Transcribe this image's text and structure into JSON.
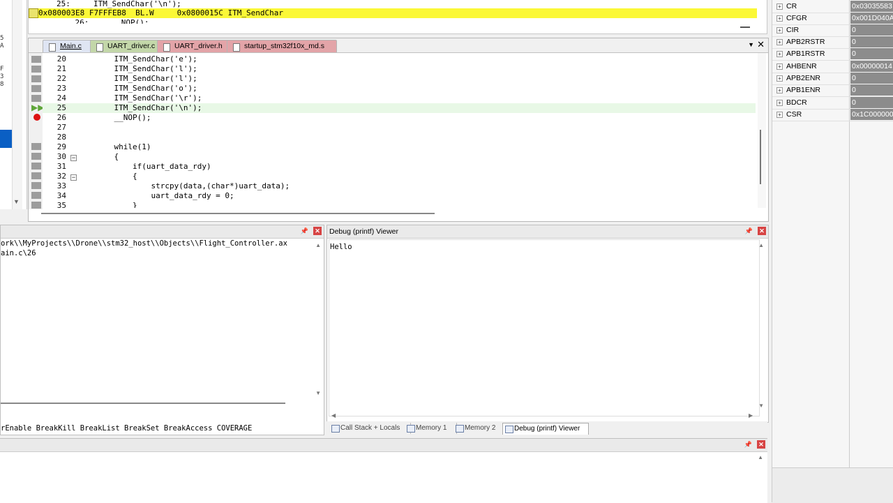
{
  "disassembly": {
    "lines": [
      {
        "text": "25:     ITM_SendChar('\\n');"
      },
      {
        "text": "0x080003E8 F7FFFEB8  BL.W     0x0800015C ITM_SendChar"
      },
      {
        "text": "    26:     __NOP();"
      }
    ]
  },
  "editor": {
    "tabs": [
      {
        "label": "Main.c"
      },
      {
        "label": "UART_driver.c"
      },
      {
        "label": "UART_driver.h"
      },
      {
        "label": "startup_stm32f10x_md.s"
      }
    ],
    "lines": [
      {
        "num": "20",
        "code": "    ITM_SendChar('e');"
      },
      {
        "num": "21",
        "code": "    ITM_SendChar('l');"
      },
      {
        "num": "22",
        "code": "    ITM_SendChar('l');"
      },
      {
        "num": "23",
        "code": "    ITM_SendChar('o');"
      },
      {
        "num": "24",
        "code": "    ITM_SendChar('\\r');"
      },
      {
        "num": "25",
        "code": "    ITM_SendChar('\\n');"
      },
      {
        "num": "26",
        "code": "    __NOP();"
      },
      {
        "num": "27",
        "code": ""
      },
      {
        "num": "28",
        "code": ""
      },
      {
        "num": "29",
        "code": "    while(1)"
      },
      {
        "num": "30",
        "code": "    {"
      },
      {
        "num": "31",
        "code": "        if(uart_data_rdy)"
      },
      {
        "num": "32",
        "code": "        {"
      },
      {
        "num": "33",
        "code": "            strcpy(data,(char*)uart_data);"
      },
      {
        "num": "34",
        "code": "            uart_data_rdy = 0;"
      },
      {
        "num": "35",
        "code": "        }"
      }
    ]
  },
  "build": {
    "lines": [
      "ork\\\\MyProjects\\\\Drone\\\\stm32_host\\\\Objects\\\\Flight_Controller.ax",
      "ain.c\\26"
    ],
    "command_line": "rEnable BreakKill BreakList BreakSet BreakAccess COVERAGE"
  },
  "debug_viewer": {
    "title": "Debug (printf) Viewer",
    "output": "Hello"
  },
  "bottom_tabs": [
    {
      "label": "Call Stack + Locals"
    },
    {
      "label": "Memory 1"
    },
    {
      "label": "Memory 2"
    },
    {
      "label": "Debug (printf) Viewer"
    }
  ],
  "registers": [
    {
      "name": "CR",
      "value": "0x03035583"
    },
    {
      "name": "CFGR",
      "value": "0x001D040A"
    },
    {
      "name": "CIR",
      "value": "0"
    },
    {
      "name": "APB2RSTR",
      "value": "0"
    },
    {
      "name": "APB1RSTR",
      "value": "0"
    },
    {
      "name": "AHBENR",
      "value": "0x00000014"
    },
    {
      "name": "APB2ENR",
      "value": "0"
    },
    {
      "name": "APB1ENR",
      "value": "0"
    },
    {
      "name": "BDCR",
      "value": "0"
    },
    {
      "name": "CSR",
      "value": "0x1C000000"
    }
  ],
  "left_strip_chars": "5 A     F 3 8",
  "colors": {
    "current_line": "#fbf837",
    "breakpoint": "#dd1111",
    "selection": "#0a5fc4",
    "close_button": "#d74444"
  }
}
